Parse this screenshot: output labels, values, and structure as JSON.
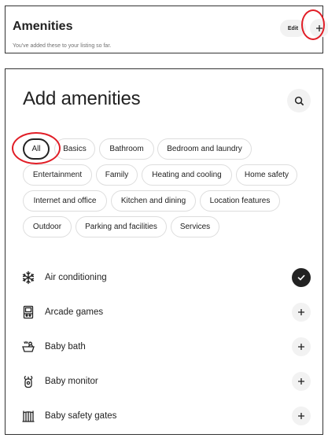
{
  "listing_amenities": {
    "title": "Amenities",
    "subtitle": "You've added these to your listing so far.",
    "edit_label": "Edit",
    "add_icon": "plus-icon"
  },
  "add_panel": {
    "title": "Add amenities",
    "search_icon": "search-icon",
    "filters": [
      {
        "label": "All",
        "selected": true
      },
      {
        "label": "Basics",
        "selected": false
      },
      {
        "label": "Bathroom",
        "selected": false
      },
      {
        "label": "Bedroom and laundry",
        "selected": false
      },
      {
        "label": "Entertainment",
        "selected": false
      },
      {
        "label": "Family",
        "selected": false
      },
      {
        "label": "Heating and cooling",
        "selected": false
      },
      {
        "label": "Home safety",
        "selected": false
      },
      {
        "label": "Internet and office",
        "selected": false
      },
      {
        "label": "Kitchen and dining",
        "selected": false
      },
      {
        "label": "Location features",
        "selected": false
      },
      {
        "label": "Outdoor",
        "selected": false
      },
      {
        "label": "Parking and facilities",
        "selected": false
      },
      {
        "label": "Services",
        "selected": false
      }
    ],
    "amenities": [
      {
        "label": "Air conditioning",
        "icon": "snowflake-icon",
        "added": true
      },
      {
        "label": "Arcade games",
        "icon": "arcade-cabinet-icon",
        "added": false
      },
      {
        "label": "Baby bath",
        "icon": "baby-bath-icon",
        "added": false
      },
      {
        "label": "Baby monitor",
        "icon": "baby-monitor-icon",
        "added": false
      },
      {
        "label": "Baby safety gates",
        "icon": "safety-gate-icon",
        "added": false
      }
    ]
  },
  "colors": {
    "annotation_red": "#e11d26",
    "text": "#222222",
    "muted": "#717171",
    "chip_border": "#dddddd",
    "button_gray": "#f2f2f2"
  }
}
